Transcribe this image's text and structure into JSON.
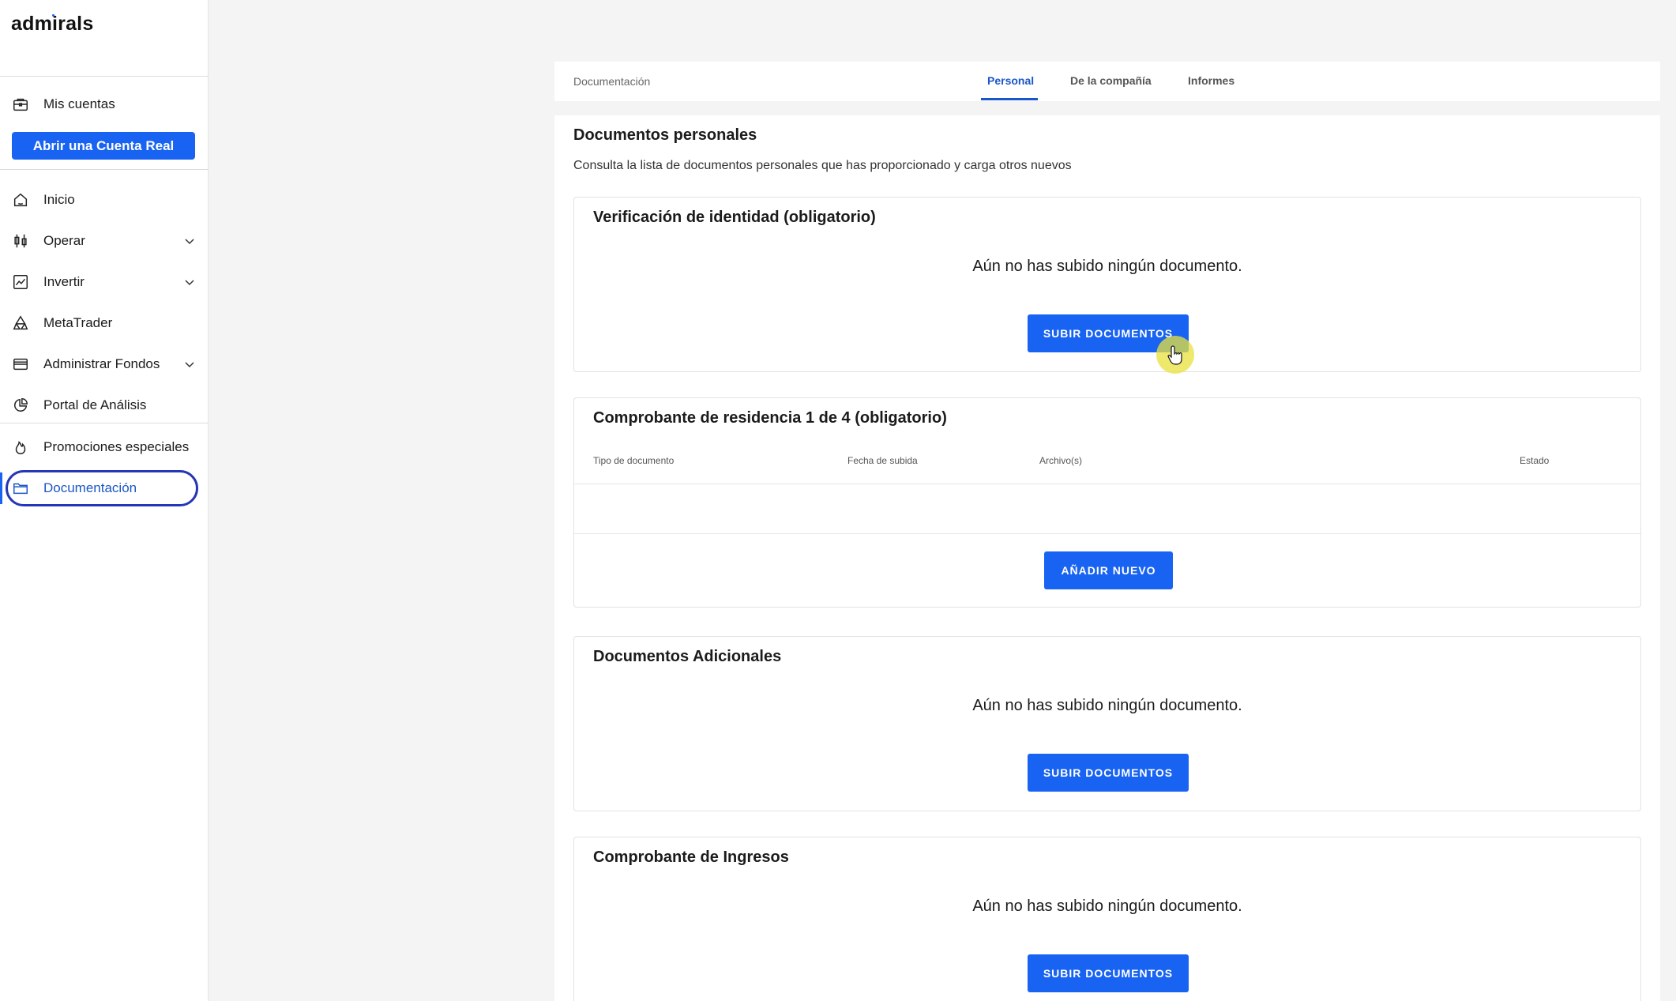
{
  "brand": {
    "logo_text": "admirals",
    "accent_color": "#1863f2"
  },
  "sidebar": {
    "my_accounts": {
      "label": "Mis cuentas",
      "icon": "briefcase-icon"
    },
    "open_account_button": "Abrir una Cuenta Real",
    "items": [
      {
        "label": "Inicio",
        "icon": "home-icon",
        "has_chevron": false
      },
      {
        "label": "Operar",
        "icon": "candlestick-icon",
        "has_chevron": true
      },
      {
        "label": "Invertir",
        "icon": "chart-line-icon",
        "has_chevron": true
      },
      {
        "label": "MetaTrader",
        "icon": "metatrader-icon",
        "has_chevron": false
      },
      {
        "label": "Administrar Fondos",
        "icon": "wallet-icon",
        "has_chevron": true
      },
      {
        "label": "Portal de Análisis",
        "icon": "pie-chart-icon",
        "has_chevron": false
      },
      {
        "label": "Promociones especiales",
        "icon": "flame-icon",
        "has_chevron": false
      },
      {
        "label": "Documentación",
        "icon": "folder-icon",
        "has_chevron": false,
        "active": true
      }
    ]
  },
  "tabbar": {
    "breadcrumb": "Documentación",
    "tabs": [
      {
        "label": "Personal",
        "active": true
      },
      {
        "label": "De la compañía",
        "active": false
      },
      {
        "label": "Informes",
        "active": false
      }
    ]
  },
  "main": {
    "title": "Documentos personales",
    "subtitle": "Consulta la lista de documentos personales que has proporcionado y carga otros nuevos",
    "sections": [
      {
        "title": "Verificación de identidad (obligatorio)",
        "empty_message": "Aún no has subido ningún documento.",
        "button": "SUBIR DOCUMENTOS"
      },
      {
        "title": "Comprobante de residencia 1 de 4 (obligatorio)",
        "columns": [
          "Tipo de documento",
          "Fecha de subida",
          "Archivo(s)",
          "Estado"
        ],
        "rows": [],
        "button": "AÑADIR NUEVO"
      },
      {
        "title": "Documentos Adicionales",
        "empty_message": "Aún no has subido ningún documento.",
        "button": "SUBIR DOCUMENTOS"
      },
      {
        "title": "Comprobante de Ingresos",
        "empty_message": "Aún no has subido ningún documento.",
        "button": "SUBIR DOCUMENTOS"
      }
    ]
  }
}
